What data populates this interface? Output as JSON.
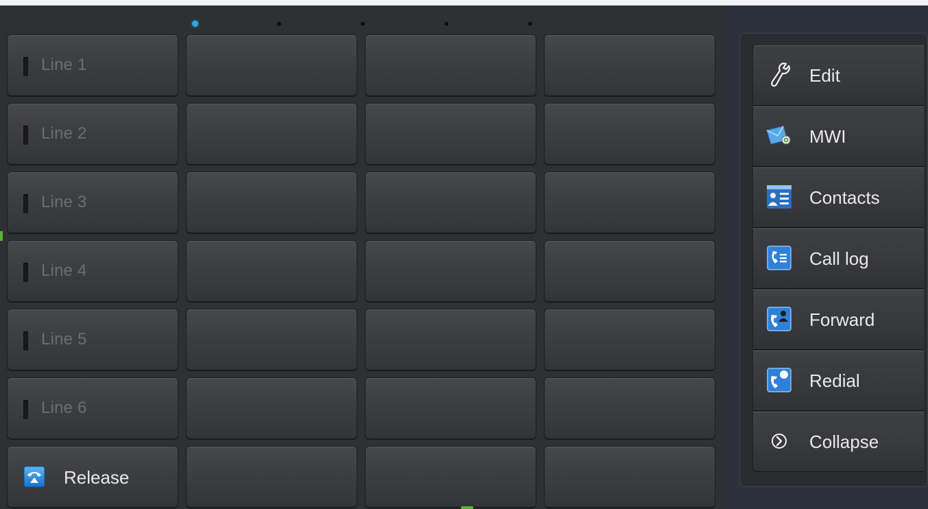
{
  "line_keys": [
    "Line 1",
    "Line 2",
    "Line 3",
    "Line 4",
    "Line 5",
    "Line 6"
  ],
  "release_label": "Release",
  "page_indicator": {
    "pages": 5,
    "active_page": 1
  },
  "side_menu": {
    "edit": {
      "label": "Edit",
      "icon": "wrench-icon"
    },
    "mwi": {
      "label": "MWI",
      "icon": "voicemail-icon"
    },
    "contacts": {
      "label": "Contacts",
      "icon": "contacts-icon"
    },
    "call_log": {
      "label": "Call log",
      "icon": "call-log-icon"
    },
    "forward": {
      "label": "Forward",
      "icon": "forward-icon"
    },
    "redial": {
      "label": "Redial",
      "icon": "redial-icon"
    },
    "collapse": {
      "label": "Collapse",
      "icon": "chevron-right-circle-icon"
    }
  },
  "colors": {
    "accent_dot": "#2aa8e6",
    "key_background": "#3d3e42",
    "screen_background": "#2c3036"
  }
}
